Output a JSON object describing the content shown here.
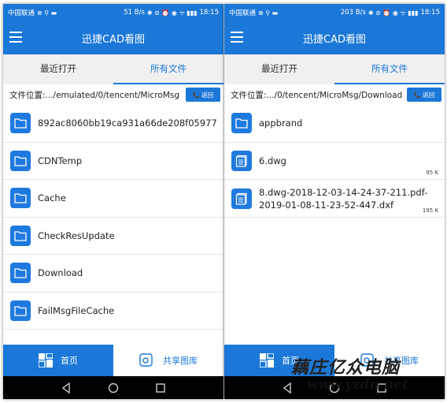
{
  "left": {
    "status": {
      "carrier": "中国联通",
      "speed": "51 B/s",
      "time": "18:15"
    },
    "title": "迅捷CAD看图",
    "tabs": [
      {
        "label": "最近打开"
      },
      {
        "label": "所有文件"
      }
    ],
    "path": "文件位置:.../emulated/0/tencent/MicroMsg",
    "back_label": "返回",
    "items": [
      {
        "name": "892ac8060bb19ca931a66de208f05977",
        "icon": "folder-icon"
      },
      {
        "name": "CDNTemp",
        "icon": "folder-icon"
      },
      {
        "name": "Cache",
        "icon": "folder-icon"
      },
      {
        "name": "CheckResUpdate",
        "icon": "folder-icon"
      },
      {
        "name": "Download",
        "icon": "folder-icon"
      },
      {
        "name": "FailMsgFileCache",
        "icon": "folder-icon"
      }
    ],
    "nav": {
      "home": "首页",
      "share": "共享图库"
    }
  },
  "right": {
    "status": {
      "carrier": "中国联通",
      "speed": "203 B/s",
      "time": "18:15"
    },
    "title": "迅捷CAD看图",
    "tabs": [
      {
        "label": "最近打开"
      },
      {
        "label": "所有文件"
      }
    ],
    "path": "文件位置:.../0/tencent/MicroMsg/Download",
    "back_label": "返回",
    "items": [
      {
        "name": "appbrand",
        "icon": "folder-icon"
      },
      {
        "name": "6.dwg",
        "size": "95 K",
        "icon": "file-icon"
      },
      {
        "name": "8.dwg-2018-12-03-14-24-37-211.pdf-2019-01-08-11-23-52-447.dxf",
        "size": "195 K",
        "icon": "file-icon"
      }
    ],
    "nav": {
      "home": "首页",
      "share": "共享图库"
    }
  },
  "watermark": {
    "name": "藕庄亿众电脑",
    "url": "www.yzdn.net"
  },
  "colors": {
    "primary": "#1b78d8",
    "folder": "#1f7ae0",
    "tab_bg": "#f0f0f0"
  }
}
